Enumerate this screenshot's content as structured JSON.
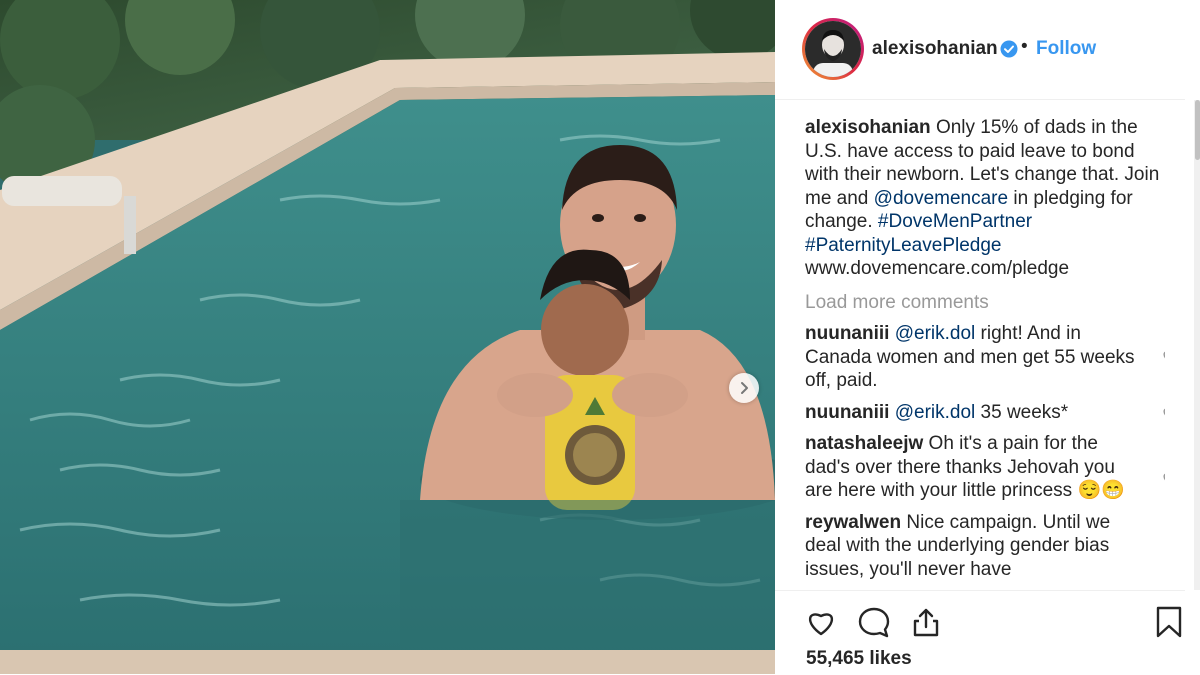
{
  "post": {
    "username": "alexisohanian",
    "follow_label": "Follow",
    "dot": "•",
    "caption": {
      "username": "alexisohanian",
      "text_1": " Only 15% of dads in the U.S. have access to paid leave to bond with their newborn. Let's change that. Join me and ",
      "mention": "@dovemencare",
      "text_2": " in pledging for change. ",
      "hashtag_1": "#DoveMenPartner",
      "hashtag_2": "#PaternityLeavePledge",
      "url": "www.dovemencare.com/pledge"
    },
    "load_more": "Load more comments",
    "comments": [
      {
        "username": "nuunaniii",
        "mention": "@erik.dol",
        "text": " right! And in Canada women and men get 55 weeks off, paid."
      },
      {
        "username": "nuunaniii",
        "mention": "@erik.dol",
        "text": " 35 weeks*"
      },
      {
        "username": "natashaleejw",
        "mention": "",
        "text": " Oh it's a pain for the dad's over there thanks Jehovah you are here with your little princess 😌😁"
      },
      {
        "username": "reywalwen",
        "mention": "",
        "text": " Nice campaign. Until we deal with the underlying gender bias issues, you'll never have"
      }
    ],
    "likes": "55,465 likes"
  },
  "icons": {
    "like": "heart-icon",
    "comment": "comment-bubble-icon",
    "share": "share-icon",
    "save": "bookmark-icon",
    "next": "chevron-right-icon",
    "verified": "verified-badge-icon"
  },
  "colors": {
    "link": "#003569",
    "follow": "#3897f0",
    "verified": "#3897f0"
  }
}
